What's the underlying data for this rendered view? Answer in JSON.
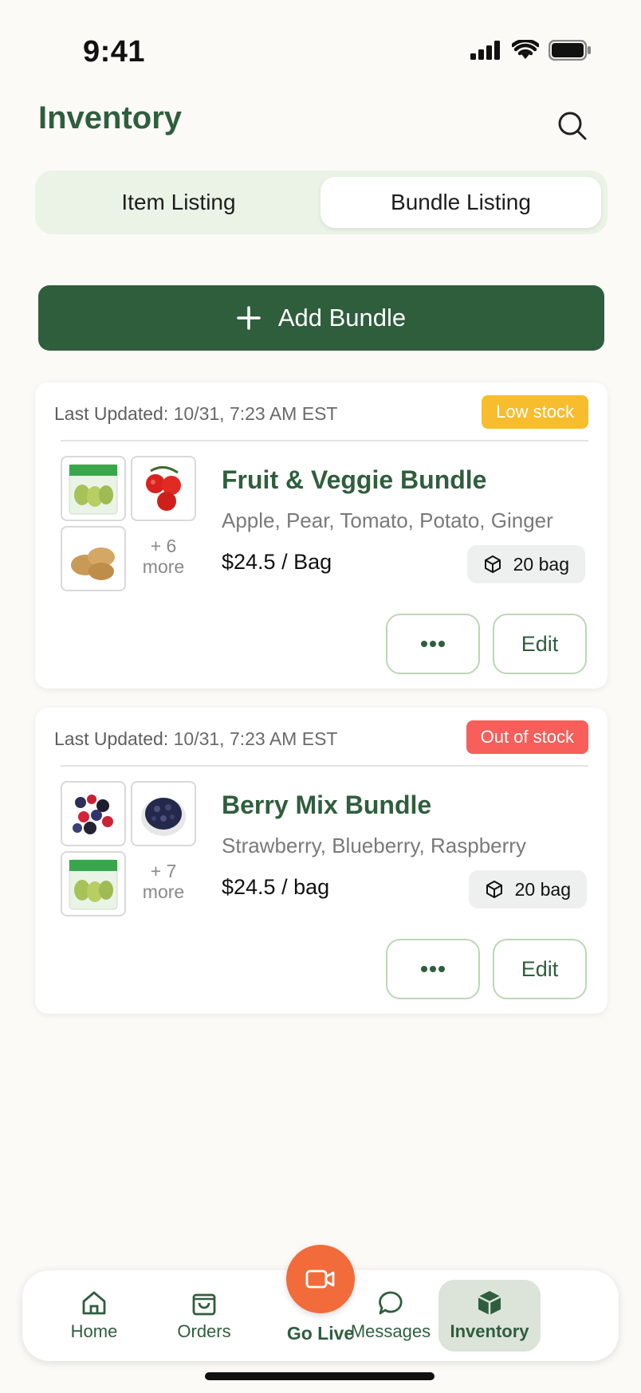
{
  "status_bar": {
    "time": "9:41"
  },
  "header": {
    "title": "Inventory"
  },
  "segments": {
    "item_listing": "Item Listing",
    "bundle_listing": "Bundle Listing",
    "selected": "Bundle Listing"
  },
  "add_button": {
    "label": "Add Bundle"
  },
  "bundles": [
    {
      "updated_label": "Last Updated:",
      "updated_value": "10/31, 7:23 AM EST",
      "badge": "Low stock",
      "name": "Fruit & Veggie Bundle",
      "items": "Apple, Pear, Tomato, Potato, Ginger",
      "price": "$24.5 / Bag",
      "quantity": "20 bag",
      "more_count": "+ 6",
      "more_label": "more",
      "edit_label": "Edit"
    },
    {
      "updated_label": "Last Updated:",
      "updated_value": "10/31, 7:23 AM EST",
      "badge": "Out of stock",
      "name": "Berry Mix Bundle",
      "items": "Strawberry, Blueberry, Raspberry",
      "price": "$24.5 / bag",
      "quantity": "20 bag",
      "more_count": "+ 7",
      "more_label": "more",
      "edit_label": "Edit"
    }
  ],
  "tabbar": {
    "home": "Home",
    "orders": "Orders",
    "go_live": "Go Live",
    "messages": "Messages",
    "inventory": "Inventory",
    "active": "Inventory"
  },
  "colors": {
    "brand_green": "#2f5e3d",
    "low_stock": "#f8bd2c",
    "out_of_stock": "#f85e5a",
    "go_live": "#f26b3a"
  }
}
